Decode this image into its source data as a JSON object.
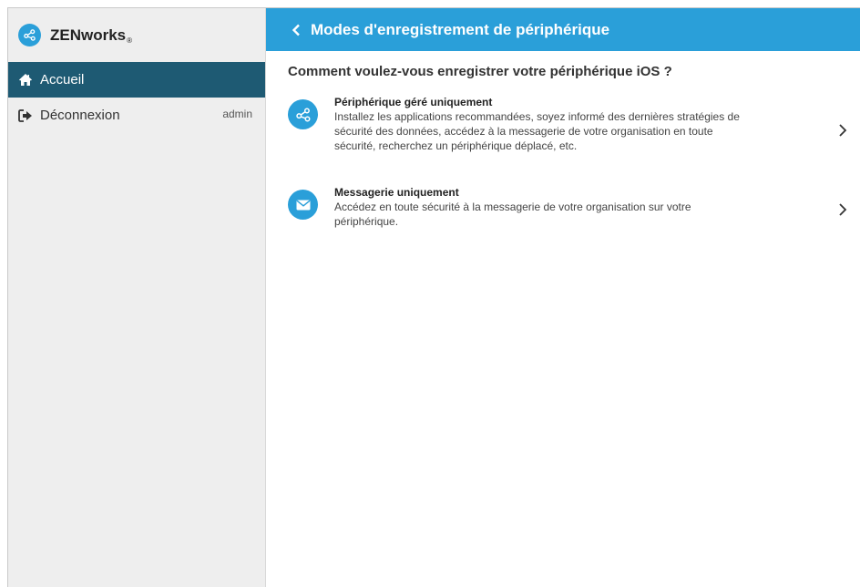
{
  "sidebar": {
    "brand": {
      "name": "ZENworks",
      "mark": "®"
    },
    "items": [
      {
        "label": "Accueil",
        "icon": "home-icon"
      },
      {
        "label": "Déconnexion",
        "icon": "logout-icon",
        "user": "admin"
      }
    ]
  },
  "header": {
    "title": "Modes d'enregistrement de périphérique",
    "back_icon": "chevron-left-icon"
  },
  "main": {
    "question": "Comment voulez-vous enregistrer votre périphérique iOS ?",
    "options": [
      {
        "title": "Périphérique géré uniquement",
        "description": "Installez les applications recommandées, soyez informé des dernières stratégies de sécurité des données, accédez à la messagerie de votre organisation en toute sécurité, recherchez un périphérique déplacé, etc.",
        "icon": "share-icon"
      },
      {
        "title": "Messagerie uniquement",
        "description": "Accédez en toute sécurité à la messagerie de votre organisation sur votre périphérique.",
        "icon": "envelope-icon"
      }
    ]
  },
  "colors": {
    "accent": "#2a9fd9",
    "nav_active": "#1e5a73",
    "sidebar_bg": "#eeeeee"
  }
}
